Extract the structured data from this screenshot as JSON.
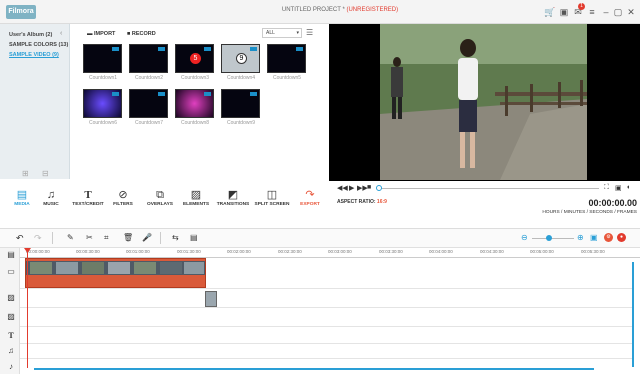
{
  "app": {
    "logo_text": "Filmora",
    "title": "UNTITLED PROJECT *",
    "unregistered": "(UNREGISTERED)",
    "notification_count": "1"
  },
  "sidebar": {
    "items": [
      {
        "label": "User's Album (2)",
        "active": false
      },
      {
        "label": "SAMPLE COLORS (13)",
        "active": false
      },
      {
        "label": "SAMPLE VIDEO (9)",
        "active": true
      }
    ]
  },
  "browser": {
    "import_label": "IMPORT",
    "record_label": "RECORD",
    "filter_value": "ALL",
    "thumbnails": [
      {
        "label": "Countdown1"
      },
      {
        "label": "Countdown2"
      },
      {
        "label": "Countdown3"
      },
      {
        "label": "Countdown4"
      },
      {
        "label": "Countdown5"
      },
      {
        "label": "Countdown6"
      },
      {
        "label": "Countdown7"
      },
      {
        "label": "Countdown8"
      },
      {
        "label": "Countdown9"
      }
    ]
  },
  "player": {
    "aspect_label": "ASPECT RATIO:",
    "aspect_value": "16:9",
    "timecode": "00:00:00.00",
    "timecode_format": "HOURS / MINUTES / SECONDS / FRAMES"
  },
  "toolbar": {
    "items": [
      {
        "label": "MEDIA",
        "icon": "media-icon"
      },
      {
        "label": "MUSIC",
        "icon": "music-icon"
      },
      {
        "label": "TEXT/CREDIT",
        "icon": "text-icon"
      },
      {
        "label": "FILTERS",
        "icon": "filters-icon"
      },
      {
        "label": "OVERLAYS",
        "icon": "overlays-icon"
      },
      {
        "label": "ELEMENTS",
        "icon": "elements-icon"
      },
      {
        "label": "TRANSITIONS",
        "icon": "transitions-icon"
      },
      {
        "label": "SPLIT SCREEN",
        "icon": "split-screen-icon"
      },
      {
        "label": "EXPORT",
        "icon": "export-icon"
      }
    ]
  },
  "timeline": {
    "ruler_ticks": [
      "00:00:00:00",
      "00:00:30:00",
      "00:01:00:00",
      "00:01:30:00",
      "00:02:00:00",
      "00:02:30:00",
      "00:03:00:00",
      "00:03:30:00",
      "00:04:00:00",
      "00:04:30:00",
      "00:05:00:00",
      "00:05:30:00"
    ]
  },
  "colors": {
    "accent": "#2a9fd6",
    "export": "#e8563a",
    "clip": "#d95a3a"
  }
}
